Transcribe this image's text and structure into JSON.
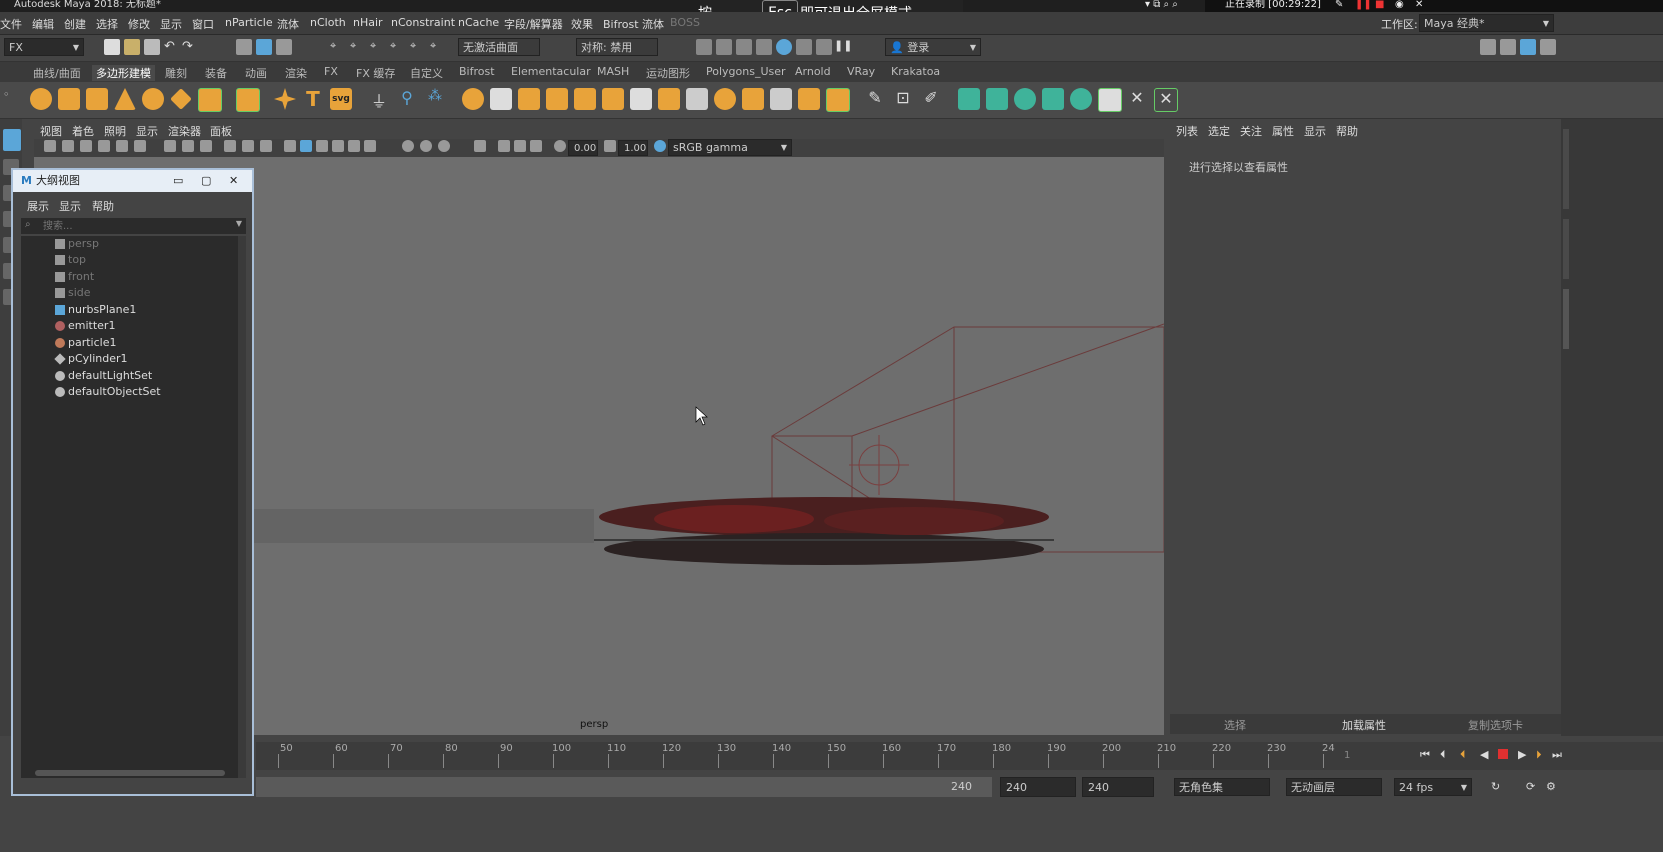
{
  "app": {
    "title": "Autodesk Maya 2018: 无标题*"
  },
  "recording": {
    "status": "正在录制 [00:29:22]"
  },
  "esc_hint": {
    "pre": "按",
    "key": "Esc",
    "post": "即可退出全屏模式"
  },
  "menubar": {
    "items": [
      "文件",
      "编辑",
      "创建",
      "选择",
      "修改",
      "显示",
      "窗口",
      "nParticle",
      "流体",
      "nCloth",
      "nHair",
      "nConstraint",
      "nCache",
      "字段/解算器",
      "效果",
      "Bifrost 流体",
      "BOSS"
    ],
    "workspace_label": "工作区:",
    "workspace_value": "Maya 经典*"
  },
  "statusline": {
    "menuset": "FX",
    "live_surface": "无激活曲面",
    "symmetry": "对称: 禁用",
    "login": "登录"
  },
  "shelf": {
    "tabs": [
      "曲线/曲面",
      "多边形建模",
      "雕刻",
      "装备",
      "动画",
      "渲染",
      "FX",
      "FX 缓存",
      "自定义",
      "Bifrost",
      "Elementacular",
      "MASH",
      "运动图形",
      "Polygons_User",
      "Arnold",
      "VRay",
      "Krakatoa"
    ],
    "active_tab": 1,
    "svg_label": "svg",
    "text_label": "T"
  },
  "viewport": {
    "menu": [
      "视图",
      "着色",
      "照明",
      "显示",
      "渲染器",
      "面板"
    ],
    "exposure": "0.00",
    "gamma": "1.00",
    "colorspace": "sRGB gamma",
    "camera_label": "persp"
  },
  "outliner": {
    "title": "大纲视图",
    "menu": [
      "展示",
      "显示",
      "帮助"
    ],
    "search_placeholder": "搜索...",
    "items": [
      {
        "name": "persp",
        "icon": "camera-icon",
        "dim": true
      },
      {
        "name": "top",
        "icon": "camera-icon",
        "dim": true
      },
      {
        "name": "front",
        "icon": "camera-icon",
        "dim": true
      },
      {
        "name": "side",
        "icon": "camera-icon",
        "dim": true
      },
      {
        "name": "nurbsPlane1",
        "icon": "nurbs-plane-icon",
        "dim": false
      },
      {
        "name": "emitter1",
        "icon": "emitter-icon",
        "dim": false
      },
      {
        "name": "particle1",
        "icon": "particle-icon",
        "dim": false
      },
      {
        "name": "pCylinder1",
        "icon": "transform-icon",
        "dim": false
      },
      {
        "name": "defaultLightSet",
        "icon": "set-icon",
        "dim": false
      },
      {
        "name": "defaultObjectSet",
        "icon": "set-icon",
        "dim": false
      }
    ]
  },
  "attribute_editor": {
    "menu": [
      "列表",
      "选定",
      "关注",
      "属性",
      "显示",
      "帮助"
    ],
    "message": "进行选择以查看属性",
    "buttons": [
      "选择",
      "加载属性",
      "复制选项卡"
    ]
  },
  "timeline": {
    "ticks": [
      "50",
      "60",
      "70",
      "80",
      "90",
      "100",
      "110",
      "120",
      "130",
      "140",
      "150",
      "160",
      "170",
      "180",
      "190",
      "200",
      "210",
      "220",
      "230",
      "24"
    ],
    "current_frame": "1"
  },
  "range": {
    "end_a": "240",
    "end_b": "240",
    "end_c": "240",
    "character_set": "无角色集",
    "anim_layer": "无动画层",
    "fps": "24 fps"
  },
  "colors": {
    "bg": "#444444",
    "viewport_bg": "#6e6e6e",
    "shelf_icon_orange": "#e8a33a",
    "shelf_icon_teal": "#3fb39a",
    "selection_blue": "#5ba6d8",
    "playback_red": "#e03030"
  }
}
